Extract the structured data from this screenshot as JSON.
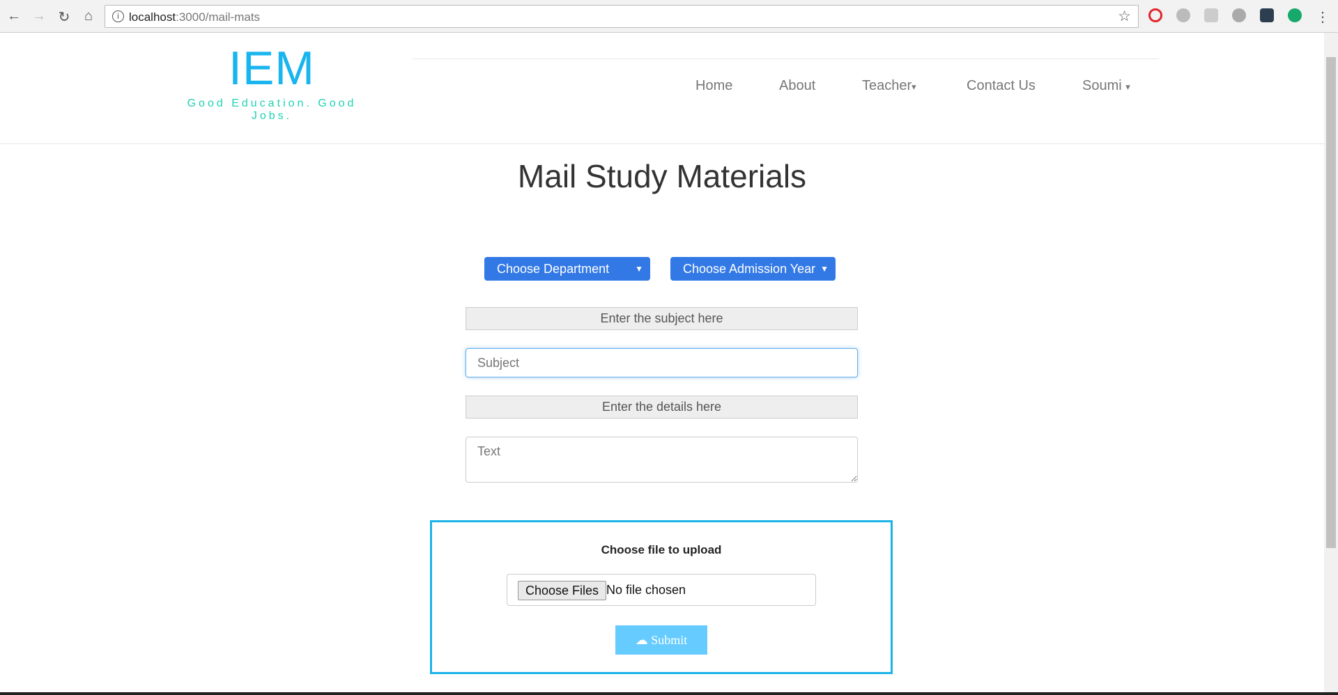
{
  "browser": {
    "url_host": "localhost",
    "url_path": ":3000/mail-mats"
  },
  "header": {
    "logo": "IEM",
    "tagline": "Good Education. Good Jobs.",
    "nav": [
      {
        "label": "Home"
      },
      {
        "label": "About"
      },
      {
        "label": "Teacher",
        "caret": "▾"
      },
      {
        "label": "Contact Us"
      },
      {
        "label": "Soumi",
        "caret": "▾"
      }
    ]
  },
  "main": {
    "title": "Mail Study Materials",
    "department_select": "Choose Department",
    "year_select": "Choose Admission Year",
    "caret": "▼",
    "subject_label": "Enter the subject here",
    "subject_placeholder": "Subject",
    "details_label": "Enter the details here",
    "details_placeholder": "Text",
    "upload": {
      "title": "Choose file to upload",
      "choose_button": "Choose Files",
      "file_status": "No file chosen",
      "submit": "Submit"
    }
  },
  "colors": {
    "accent": "#19b5ef",
    "dropdown": "#3279e6",
    "submit": "#66ccff"
  }
}
